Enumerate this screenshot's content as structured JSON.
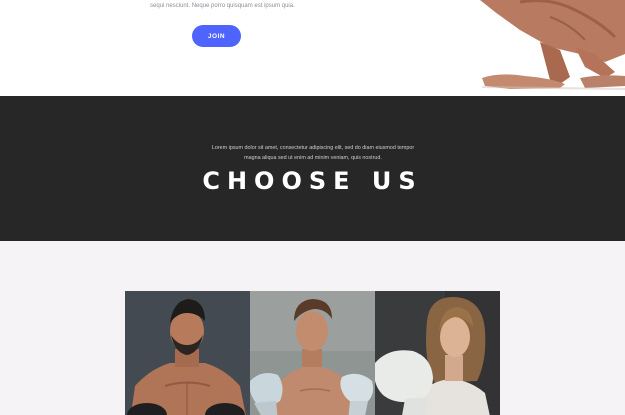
{
  "hero": {
    "subtext": "sequi nesciunt. Neque porro quisquam est ipsum quia.",
    "join_label": "JOIN"
  },
  "choose": {
    "description_line1": "Lorem ipsum dolor sit amet, consectetur adipiscing elit, sed do diam eiusmod tempor",
    "description_line2": "magna aliqua sed ut enim ad minim veniam, quis nostrud.",
    "title": "CHOOSE US"
  },
  "colors": {
    "accent": "#4f63ff",
    "dark_section": "#272727",
    "light_section": "#f6f3f6"
  },
  "gallery": {
    "images": [
      {
        "name": "bearded-boxer-photo"
      },
      {
        "name": "young-boxer-photo"
      },
      {
        "name": "female-boxer-photo"
      }
    ]
  }
}
